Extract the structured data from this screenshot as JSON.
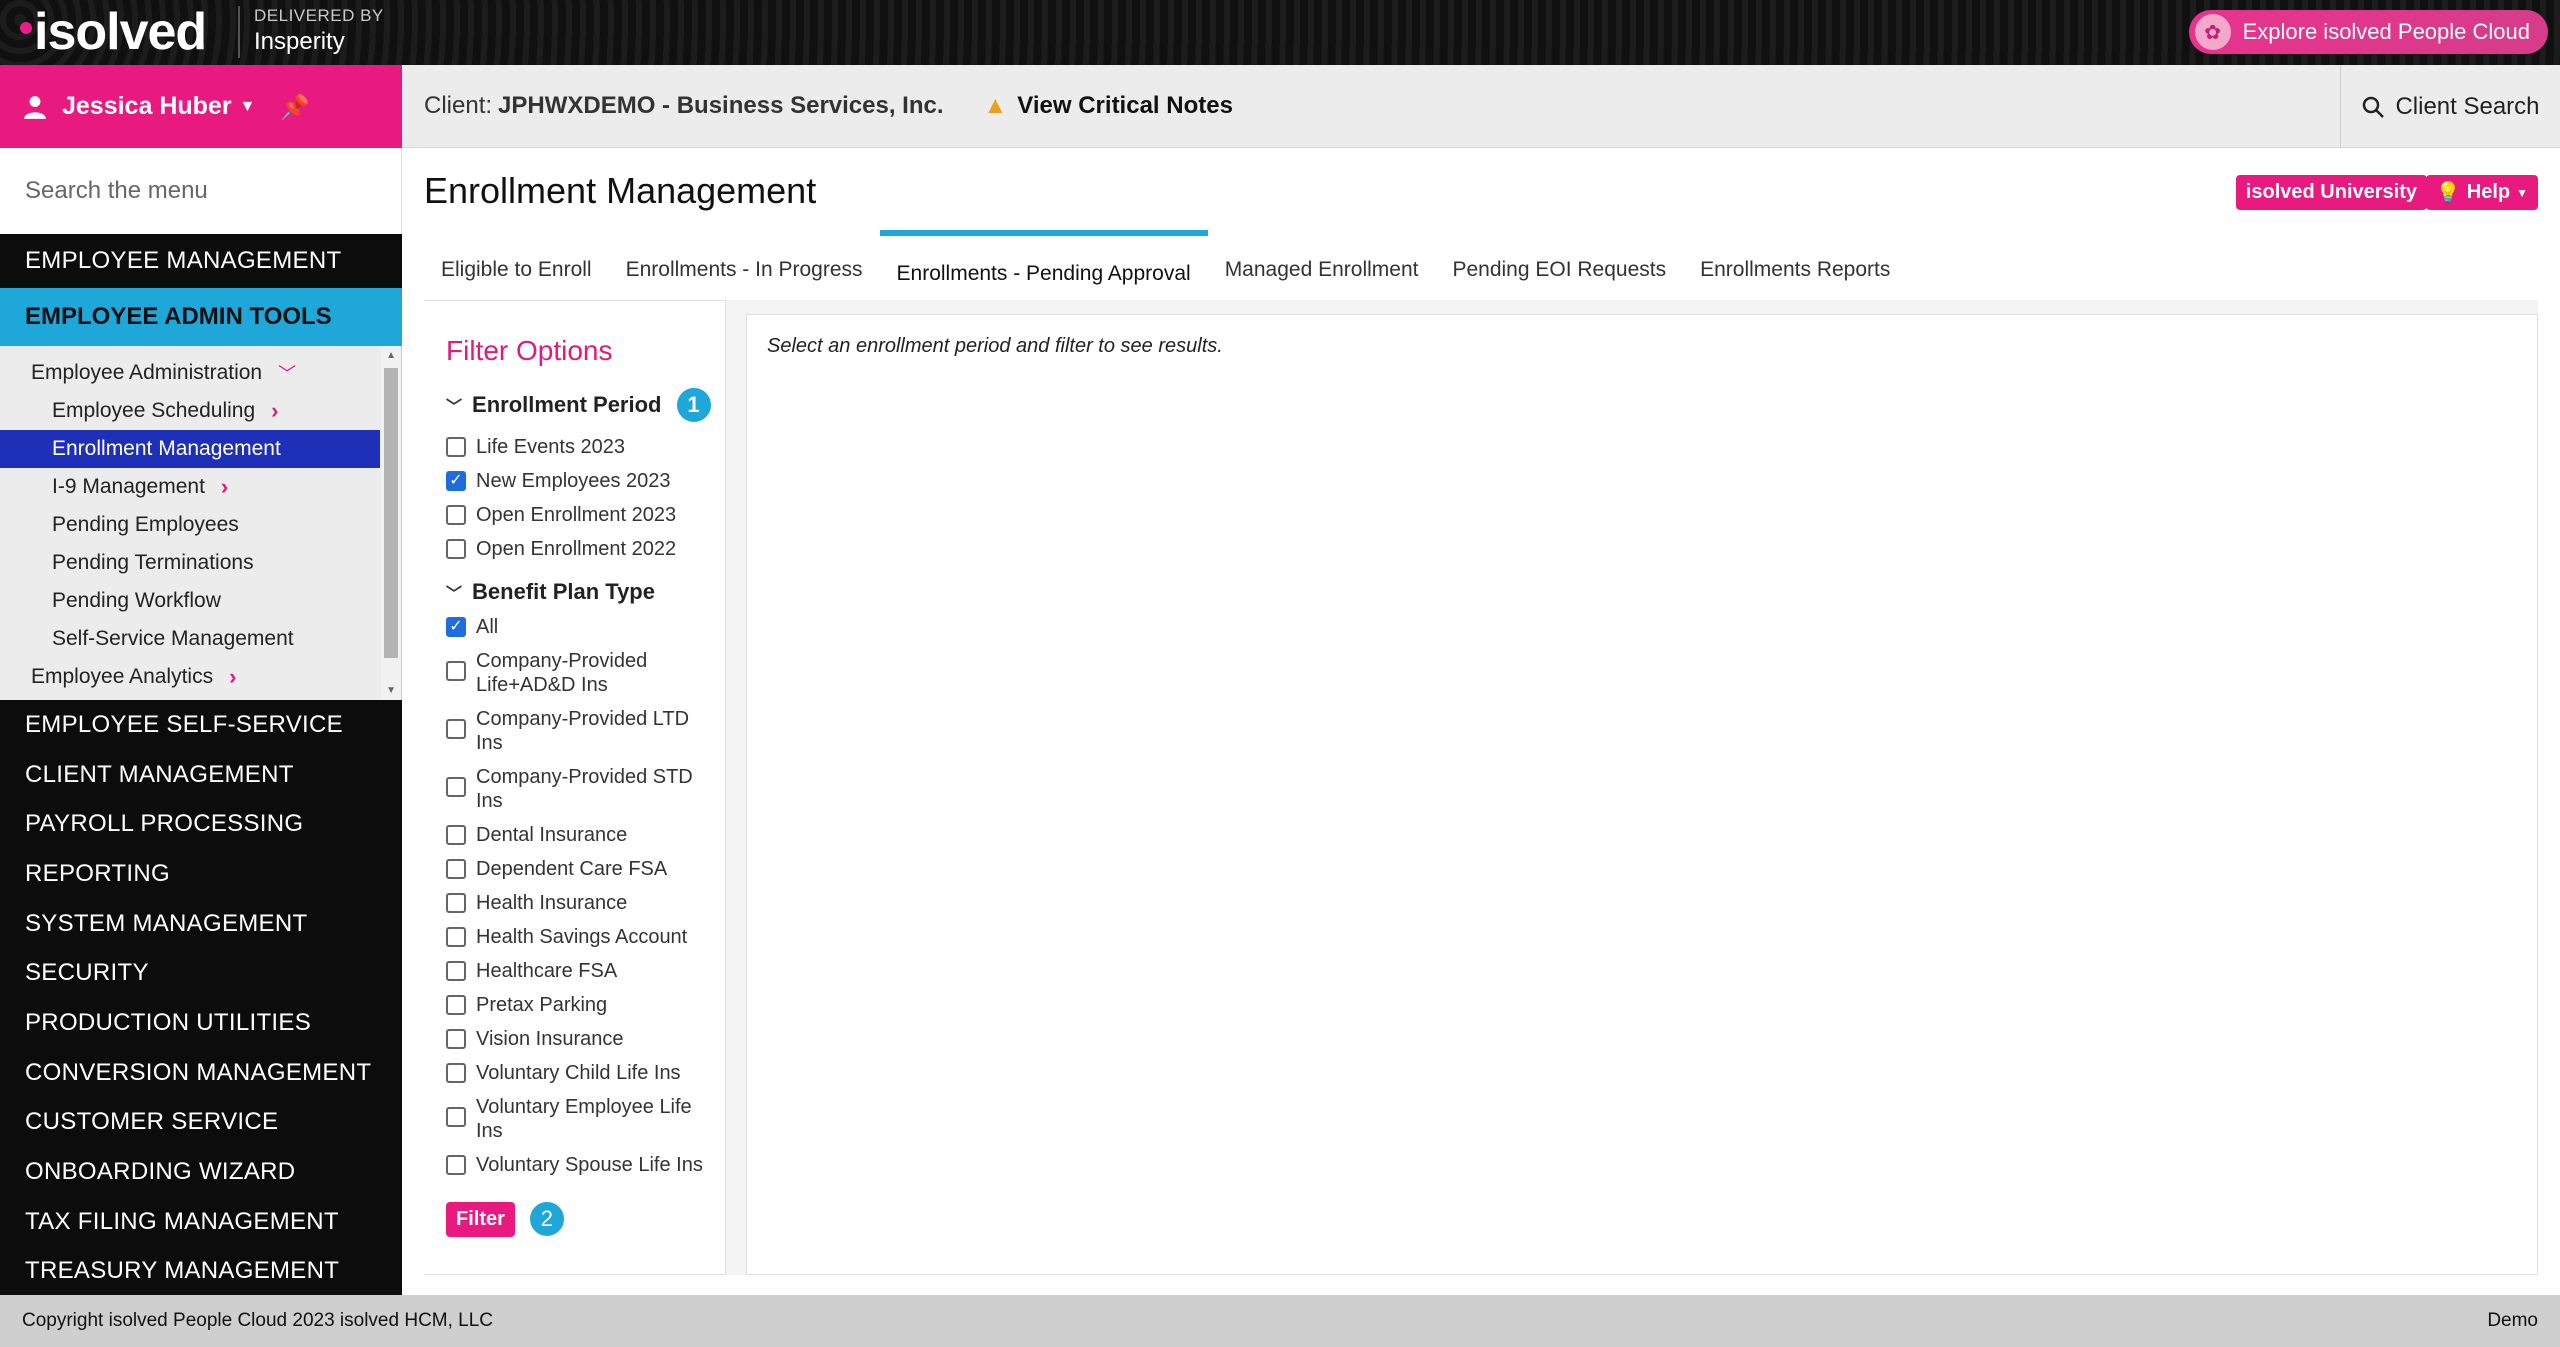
{
  "topbar": {
    "logo": "isolved",
    "delivered_by": "DELIVERED BY",
    "partner": "Insperity",
    "explore": "Explore isolved People Cloud"
  },
  "header": {
    "user_name": "Jessica Huber",
    "client_label": "Client:",
    "client_name": "JPHWXDEMO - Business Services, Inc.",
    "critical_notes": "View Critical Notes",
    "client_search": "Client Search"
  },
  "sidebar": {
    "search_placeholder": "Search the menu",
    "top_items": [
      "EMPLOYEE MANAGEMENT"
    ],
    "active_item": "EMPLOYEE ADMIN TOOLS",
    "submenu": [
      {
        "label": "Employee Administration"
      },
      {
        "label": "Employee Scheduling"
      },
      {
        "label": "Enrollment Management"
      },
      {
        "label": "I-9 Management"
      },
      {
        "label": "Pending Employees"
      },
      {
        "label": "Pending Terminations"
      },
      {
        "label": "Pending Workflow"
      },
      {
        "label": "Self-Service Management"
      },
      {
        "label": "Employee Analytics"
      }
    ],
    "bottom_items": [
      "EMPLOYEE SELF-SERVICE",
      "CLIENT MANAGEMENT",
      "PAYROLL PROCESSING",
      "REPORTING",
      "SYSTEM MANAGEMENT",
      "SECURITY",
      "PRODUCTION UTILITIES",
      "CONVERSION MANAGEMENT",
      "CUSTOMER SERVICE",
      "ONBOARDING WIZARD",
      "TAX FILING MANAGEMENT",
      "TREASURY MANAGEMENT"
    ]
  },
  "main": {
    "title": "Enrollment Management",
    "university_button": "isolved University",
    "help_button": "Help",
    "tabs": [
      "Eligible to Enroll",
      "Enrollments - In Progress",
      "Enrollments - Pending Approval",
      "Managed Enrollment",
      "Pending EOI Requests",
      "Enrollments Reports"
    ],
    "active_tab_index": 2,
    "results_message": "Select an enrollment period and filter to see results."
  },
  "filter": {
    "title": "Filter Options",
    "enrollment_period_label": "Enrollment Period",
    "badge_1": "1",
    "badge_2": "2",
    "enrollment_periods": [
      {
        "label": "Life Events 2023",
        "checked": false
      },
      {
        "label": "New Employees 2023",
        "checked": true
      },
      {
        "label": "Open Enrollment 2023",
        "checked": false
      },
      {
        "label": "Open Enrollment 2022",
        "checked": false
      }
    ],
    "benefit_plan_label": "Benefit Plan Type",
    "benefit_plans": [
      {
        "label": "All",
        "checked": true
      },
      {
        "label": "Company-Provided Life+AD&D Ins",
        "checked": false
      },
      {
        "label": "Company-Provided LTD Ins",
        "checked": false
      },
      {
        "label": "Company-Provided STD Ins",
        "checked": false
      },
      {
        "label": "Dental Insurance",
        "checked": false
      },
      {
        "label": "Dependent Care FSA",
        "checked": false
      },
      {
        "label": "Health Insurance",
        "checked": false
      },
      {
        "label": "Health Savings Account",
        "checked": false
      },
      {
        "label": "Healthcare FSA",
        "checked": false
      },
      {
        "label": "Pretax Parking",
        "checked": false
      },
      {
        "label": "Vision Insurance",
        "checked": false
      },
      {
        "label": "Voluntary Child Life Ins",
        "checked": false
      },
      {
        "label": "Voluntary Employee Life Ins",
        "checked": false
      },
      {
        "label": "Voluntary Spouse Life Ins",
        "checked": false
      }
    ],
    "filter_button": "Filter"
  },
  "footer": {
    "copyright": "Copyright isolved People Cloud 2023 isolved HCM, LLC",
    "environment": "Demo"
  },
  "colors": {
    "brand_pink": "#e8197f",
    "accent_blue": "#1ea7d8",
    "selected_nav": "#1e2fb8"
  }
}
